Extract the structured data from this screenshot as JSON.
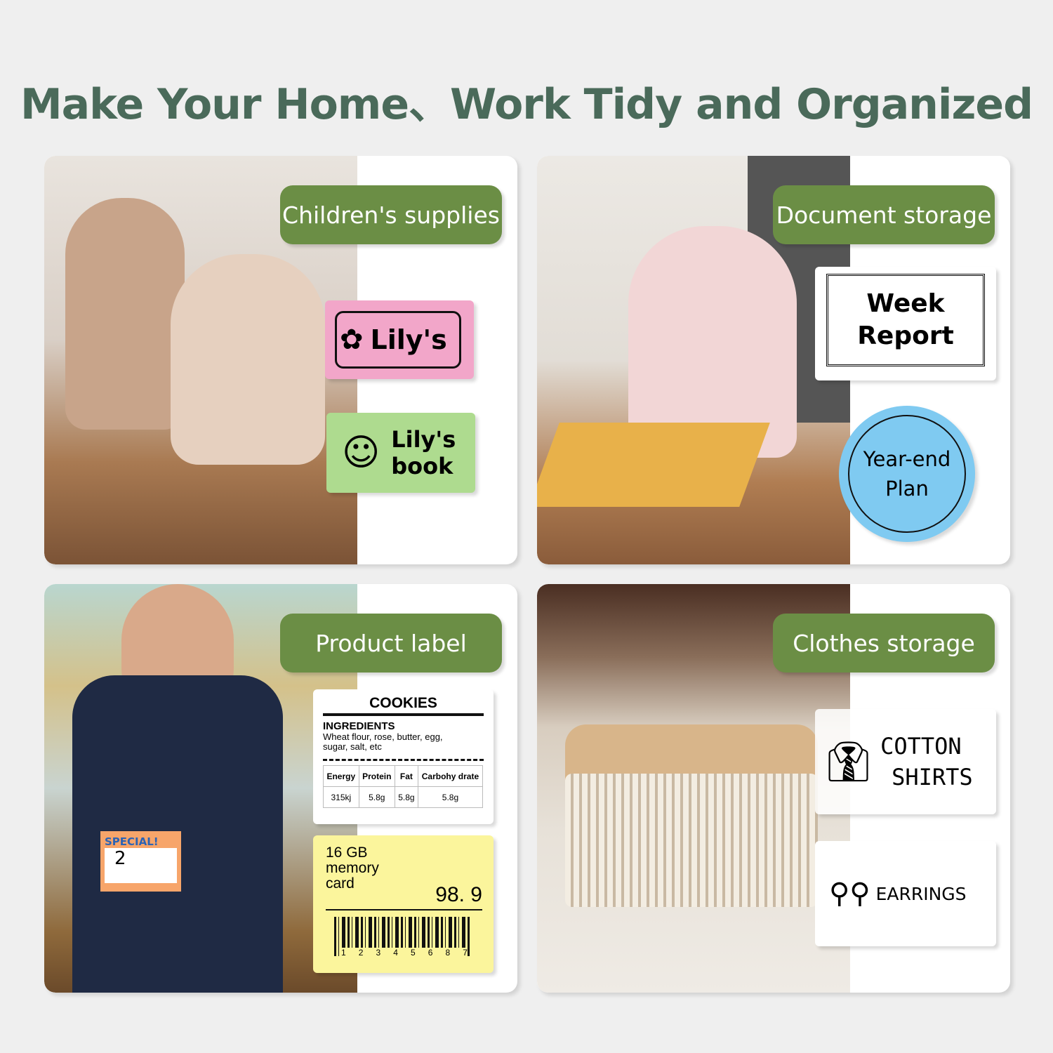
{
  "title": "Make Your Home、Work Tidy and Organized",
  "cards": [
    {
      "category": "Children's supplies",
      "labels": [
        {
          "text": "Lily's",
          "color": "#f2a6c9",
          "icon": "flower-icon"
        },
        {
          "line1": "Lily's",
          "line2": "book",
          "color": "#aedb8f",
          "icon": "girl-face-icon"
        }
      ]
    },
    {
      "category": "Document storage",
      "labels": [
        {
          "line1": "Week",
          "line2": "Report",
          "icon": "ornate-frame-icon"
        },
        {
          "line1": "Year-end",
          "line2": "Plan",
          "color": "#7fcaf1",
          "icon": "laurel-wreath-icon"
        }
      ]
    },
    {
      "category": "Product label",
      "cookie": {
        "title": "COOKIES",
        "ingredients_heading": "INGREDIENTS",
        "ingredients": "Wheat flour, rose, butter, egg, sugar, salt, etc",
        "headers": [
          "Energy",
          "Protein",
          "Fat",
          "Carbohy drate"
        ],
        "values": [
          "315kj",
          "5.8g",
          "5.8g",
          "5.8g"
        ]
      },
      "price_tag": {
        "line1": "16 GB",
        "line2": "memory",
        "line3": "card",
        "price": "98. 9",
        "barcode_digits": [
          "1",
          "2",
          "3",
          "4",
          "5",
          "6",
          "8",
          "7"
        ],
        "color": "#fbf59c"
      },
      "photo_sign": {
        "text": "SPECIAL!",
        "price": "2"
      }
    },
    {
      "category": "Clothes storage",
      "labels": [
        {
          "line1": "COTTON",
          "line2": "SHIRTS",
          "icon": "shirt-icon"
        },
        {
          "text": "EARRINGS",
          "icon": "earrings-icon"
        }
      ]
    }
  ],
  "colors": {
    "title": "#4a6a5a",
    "pill": "#6b8e45",
    "background": "#efefef"
  }
}
